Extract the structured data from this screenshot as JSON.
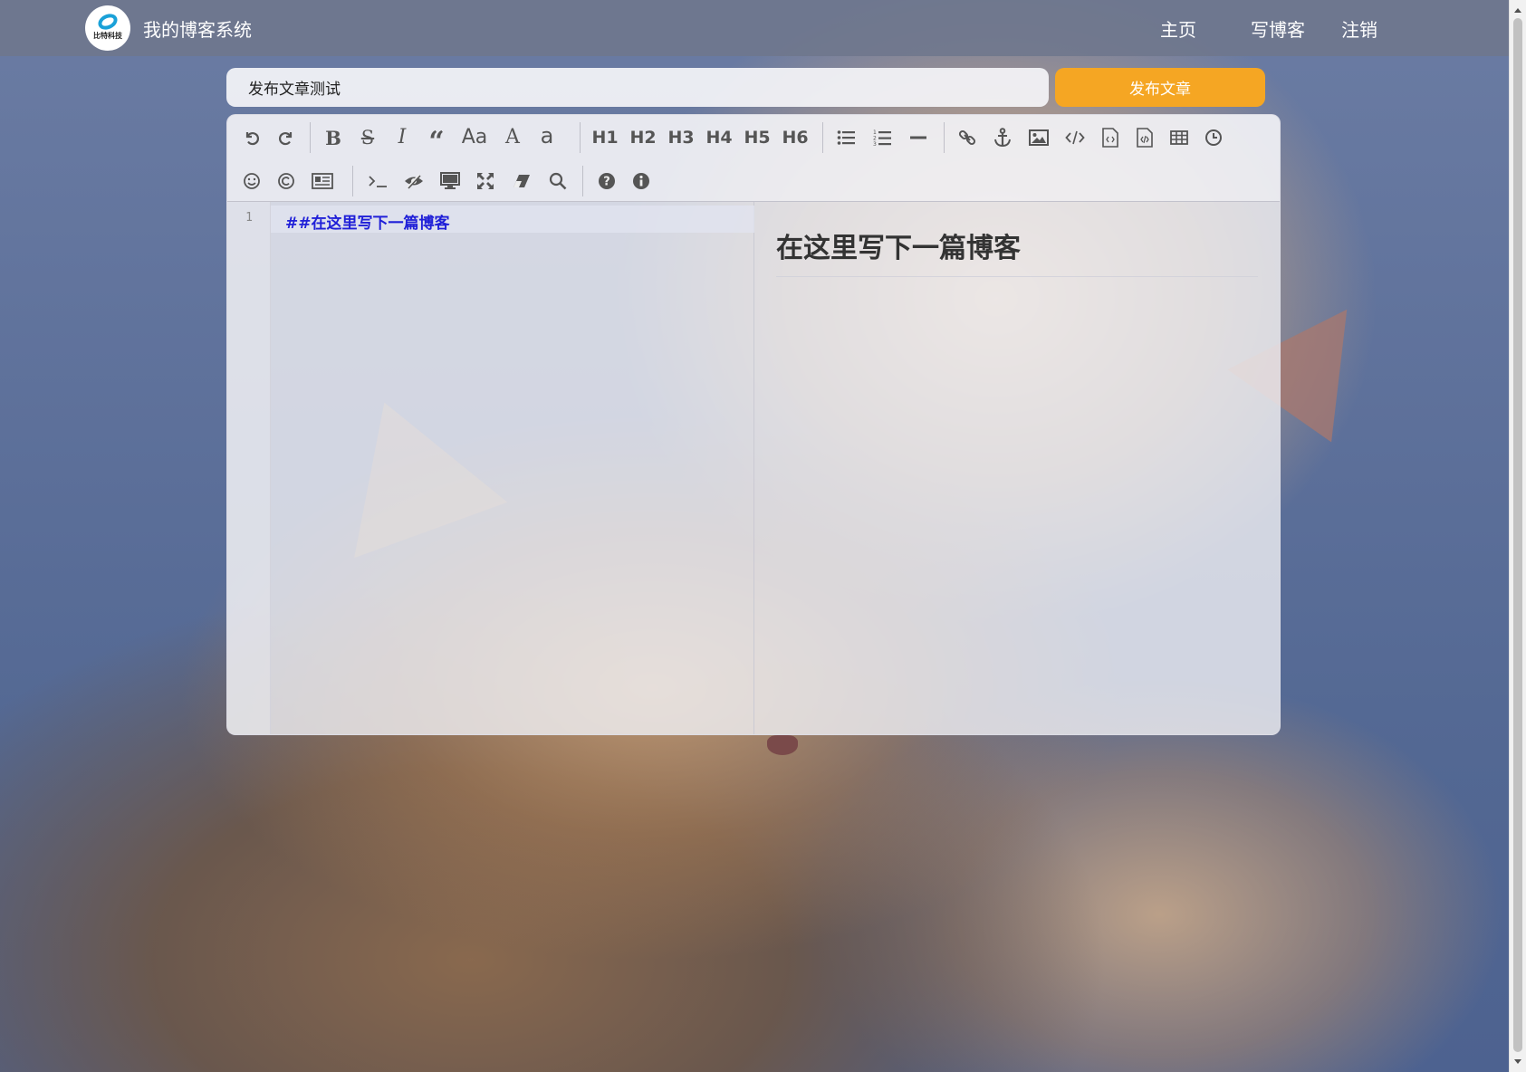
{
  "navbar": {
    "logo_text": "比特科技",
    "site_title": "我的博客系统",
    "links": [
      {
        "label": "主页"
      },
      {
        "label": "写博客"
      },
      {
        "label": "注销"
      }
    ]
  },
  "editor_page": {
    "title_value": "发布文章测试",
    "publish_label": "发布文章"
  },
  "toolbar": {
    "row1": [
      {
        "name": "undo-icon"
      },
      {
        "name": "redo-icon"
      },
      {
        "name": "bold-icon"
      },
      {
        "name": "strikethrough-icon"
      },
      {
        "name": "italic-icon"
      },
      {
        "name": "quote-icon"
      },
      {
        "name": "uppercase-icon",
        "text": "Aa"
      },
      {
        "name": "ucwords-icon",
        "text": "A"
      },
      {
        "name": "lowercase-icon",
        "text": "a"
      },
      {
        "name": "h1-button",
        "text": "H1"
      },
      {
        "name": "h2-button",
        "text": "H2"
      },
      {
        "name": "h3-button",
        "text": "H3"
      },
      {
        "name": "h4-button",
        "text": "H4"
      },
      {
        "name": "h5-button",
        "text": "H5"
      },
      {
        "name": "h6-button",
        "text": "H6"
      },
      {
        "name": "unordered-list-icon"
      },
      {
        "name": "ordered-list-icon"
      },
      {
        "name": "horizontal-rule-icon"
      },
      {
        "name": "link-icon"
      },
      {
        "name": "anchor-icon"
      },
      {
        "name": "image-icon"
      },
      {
        "name": "code-icon"
      },
      {
        "name": "preformatted-code-icon"
      },
      {
        "name": "code-block-icon"
      },
      {
        "name": "table-icon"
      },
      {
        "name": "datetime-icon"
      }
    ],
    "row2": [
      {
        "name": "emoji-icon"
      },
      {
        "name": "html-entities-icon"
      },
      {
        "name": "pagebreak-icon"
      },
      {
        "name": "goto-line-icon"
      },
      {
        "name": "watch-toggle-icon"
      },
      {
        "name": "preview-icon"
      },
      {
        "name": "fullscreen-icon"
      },
      {
        "name": "clear-icon"
      },
      {
        "name": "search-icon"
      },
      {
        "name": "help-icon"
      },
      {
        "name": "info-icon"
      }
    ]
  },
  "editor": {
    "line_number": "1",
    "markdown_line": "##在这里写下一篇博客",
    "preview_heading": "在这里写下一篇博客"
  },
  "colors": {
    "publish_button": "#f5a623",
    "markdown_text": "#2020d8",
    "navbar_bg": "#6e768c"
  }
}
